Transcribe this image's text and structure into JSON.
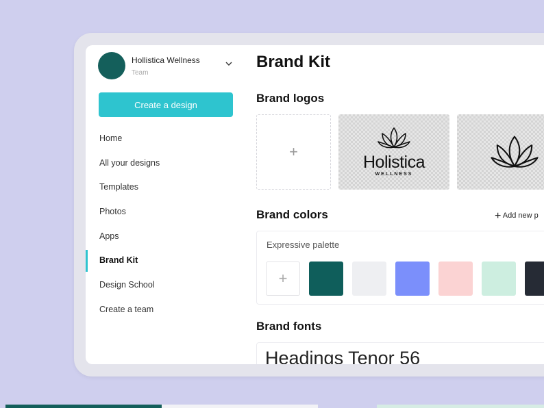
{
  "team": {
    "name": "Hollistica Wellness",
    "subtitle": "Team"
  },
  "sidebar": {
    "create_button": "Create a design",
    "items": [
      {
        "label": "Home"
      },
      {
        "label": "All your designs"
      },
      {
        "label": "Templates"
      },
      {
        "label": "Photos"
      },
      {
        "label": "Apps"
      },
      {
        "label": "Brand Kit"
      },
      {
        "label": "Design School"
      },
      {
        "label": "Create a team"
      }
    ],
    "active_index": 5
  },
  "main": {
    "title": "Brand Kit",
    "logos": {
      "title": "Brand logos",
      "add_symbol": "+",
      "logo_word": "Holistica",
      "logo_tag": "WELLNESS"
    },
    "colors": {
      "title": "Brand colors",
      "add_palette": "Add new p",
      "palette_name": "Expressive palette",
      "add_symbol": "+",
      "swatches": [
        "#0f5e5b",
        "#eeeff2",
        "#7b8ffb",
        "#fbd3d3",
        "#cdeee0",
        "#262b35"
      ]
    },
    "fonts": {
      "title": "Brand fonts",
      "sample": "Headings Tenor 56"
    }
  },
  "colors": {
    "accent": "#2ec4cf",
    "background": "#cfcfee",
    "avatar": "#145f5b"
  }
}
